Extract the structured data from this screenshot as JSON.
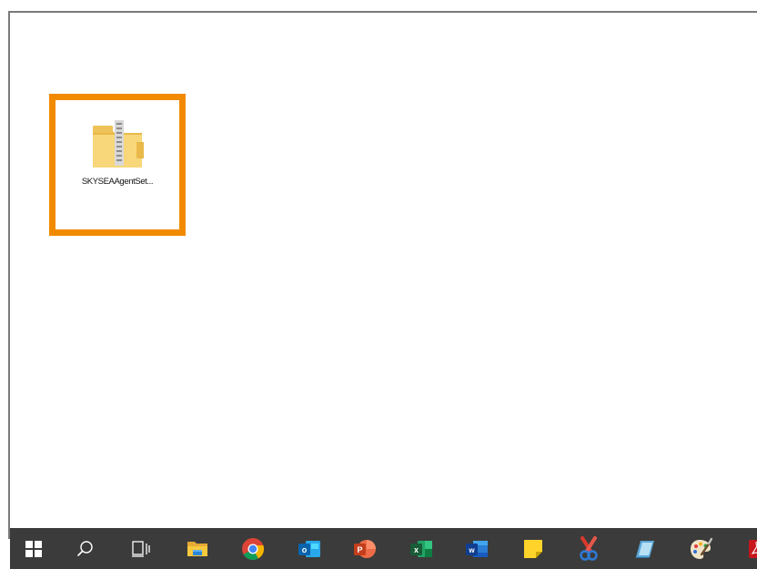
{
  "desktop": {
    "icons": [
      {
        "label": "SKYSEAAgentSet...",
        "icon": "zip-folder-icon",
        "selected": true,
        "highlight_color": "#f28a00"
      }
    ]
  },
  "taskbar": {
    "background": "#3b3b3b",
    "items": [
      {
        "name": "start",
        "icon": "windows-logo-icon"
      },
      {
        "name": "search",
        "icon": "search-icon"
      },
      {
        "name": "task-view",
        "icon": "task-view-icon"
      },
      {
        "name": "file-explorer",
        "icon": "file-explorer-icon"
      },
      {
        "name": "chrome",
        "icon": "chrome-icon"
      },
      {
        "name": "outlook",
        "icon": "outlook-icon"
      },
      {
        "name": "powerpoint",
        "icon": "powerpoint-icon"
      },
      {
        "name": "excel",
        "icon": "excel-icon"
      },
      {
        "name": "word",
        "icon": "word-icon"
      },
      {
        "name": "sticky-notes",
        "icon": "sticky-notes-icon"
      },
      {
        "name": "snipping-tool",
        "icon": "snipping-tool-icon"
      },
      {
        "name": "notepad",
        "icon": "notepad-icon"
      },
      {
        "name": "paint",
        "icon": "paint-icon"
      },
      {
        "name": "acrobat",
        "icon": "acrobat-icon"
      }
    ]
  }
}
